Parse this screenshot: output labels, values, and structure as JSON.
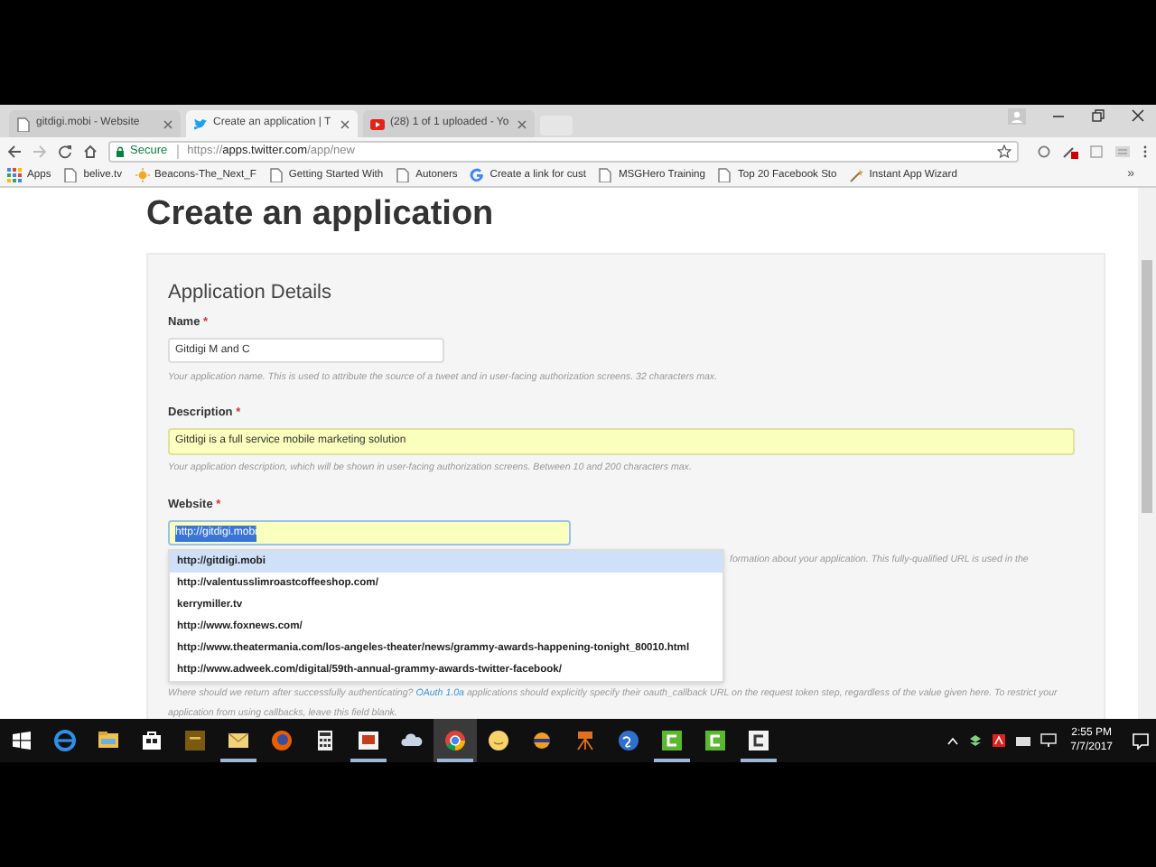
{
  "tabs": [
    {
      "kind": "page",
      "title": "gitdigi.mobi - Website",
      "selected": false
    },
    {
      "kind": "bird",
      "title": "Create an application | T",
      "selected": true
    },
    {
      "kind": "video",
      "title": "(28) 1 of 1 uploaded - Yo",
      "selected": false
    }
  ],
  "address": {
    "secure_label": "Secure",
    "scheme": "https://",
    "host": "apps.twitter.com",
    "path": "/app/new"
  },
  "bookmarks": [
    {
      "kind": "apps",
      "label": "Apps"
    },
    {
      "kind": "page",
      "label": "belive.tv"
    },
    {
      "kind": "beacon",
      "label": "Beacons-The_Next_F"
    },
    {
      "kind": "page",
      "label": "Getting Started With"
    },
    {
      "kind": "page",
      "label": "Autoners"
    },
    {
      "kind": "google",
      "label": "Create a link for cust"
    },
    {
      "kind": "page",
      "label": "MSGHero Training"
    },
    {
      "kind": "page",
      "label": "Top 20 Facebook Sto"
    },
    {
      "kind": "wizard",
      "label": "Instant App Wizard"
    }
  ],
  "bookmarks_more": "»",
  "page": {
    "heading": "Create an application",
    "section": "Application Details",
    "name": {
      "label": "Name",
      "required": "*",
      "value": "Gitdigi M and C",
      "hint": "Your application name. This is used to attribute the source of a tweet and in user-facing authorization screens. 32 characters max.",
      "autofilled": false
    },
    "description": {
      "label": "Description",
      "required": "*",
      "value": "Gitdigi is a full service mobile marketing solution",
      "hint": "Your application description, which will be shown in user-facing authorization screens. Between 10 and 200 characters max.",
      "autofilled": true
    },
    "website": {
      "label": "Website",
      "required": "*",
      "value": "http://gitdigi.mobi",
      "autofilled": true,
      "hint_visible": "formation about your application. This fully-qualified URL is used in the"
    },
    "suggestions": [
      {
        "text": "http://gitdigi.mobi",
        "selected": true
      },
      {
        "text": "http://valentusslimroastcoffeeshop.com/",
        "selected": false
      },
      {
        "text": "kerrymiller.tv",
        "selected": false
      },
      {
        "text": "http://www.foxnews.com/",
        "selected": false
      },
      {
        "text": "http://www.theatermania.com/los-angeles-theater/news/grammy-awards-happening-tonight_80010.html",
        "selected": false
      },
      {
        "text": "http://www.adweek.com/digital/59th-annual-grammy-awards-twitter-facebook/",
        "selected": false
      }
    ],
    "callback_hint": {
      "before": "Where should we return after successfully authenticating?",
      "link": "OAuth 1.0a",
      "after": "applications should explicitly specify their oauth_callback URL on the request token step, regardless of the value given here. To restrict your application from using callbacks, leave this field blank."
    }
  },
  "taskbar": {
    "apps": [
      {
        "kind": "edge",
        "running": false,
        "focused": false
      },
      {
        "kind": "folder",
        "running": false,
        "focused": false
      },
      {
        "kind": "store",
        "running": false,
        "focused": false
      },
      {
        "kind": "fw",
        "running": false,
        "focused": false
      },
      {
        "kind": "mail",
        "running": true,
        "focused": false
      },
      {
        "kind": "firefox",
        "running": false,
        "focused": false
      },
      {
        "kind": "calculator",
        "running": false,
        "focused": false
      },
      {
        "kind": "slides",
        "running": true,
        "focused": false
      },
      {
        "kind": "cloud",
        "running": false,
        "focused": false
      },
      {
        "kind": "chrome",
        "running": true,
        "focused": true
      },
      {
        "kind": "smiley",
        "running": false,
        "focused": false
      },
      {
        "kind": "ball",
        "running": false,
        "focused": false
      },
      {
        "kind": "projector",
        "running": false,
        "focused": false
      },
      {
        "kind": "sphere",
        "running": false,
        "focused": false
      },
      {
        "kind": "camtasia",
        "running": true,
        "focused": false
      },
      {
        "kind": "camtasia",
        "running": false,
        "focused": false
      },
      {
        "kind": "recorder",
        "running": true,
        "focused": false
      }
    ],
    "time": "2:55 PM",
    "date": "7/7/2017"
  }
}
